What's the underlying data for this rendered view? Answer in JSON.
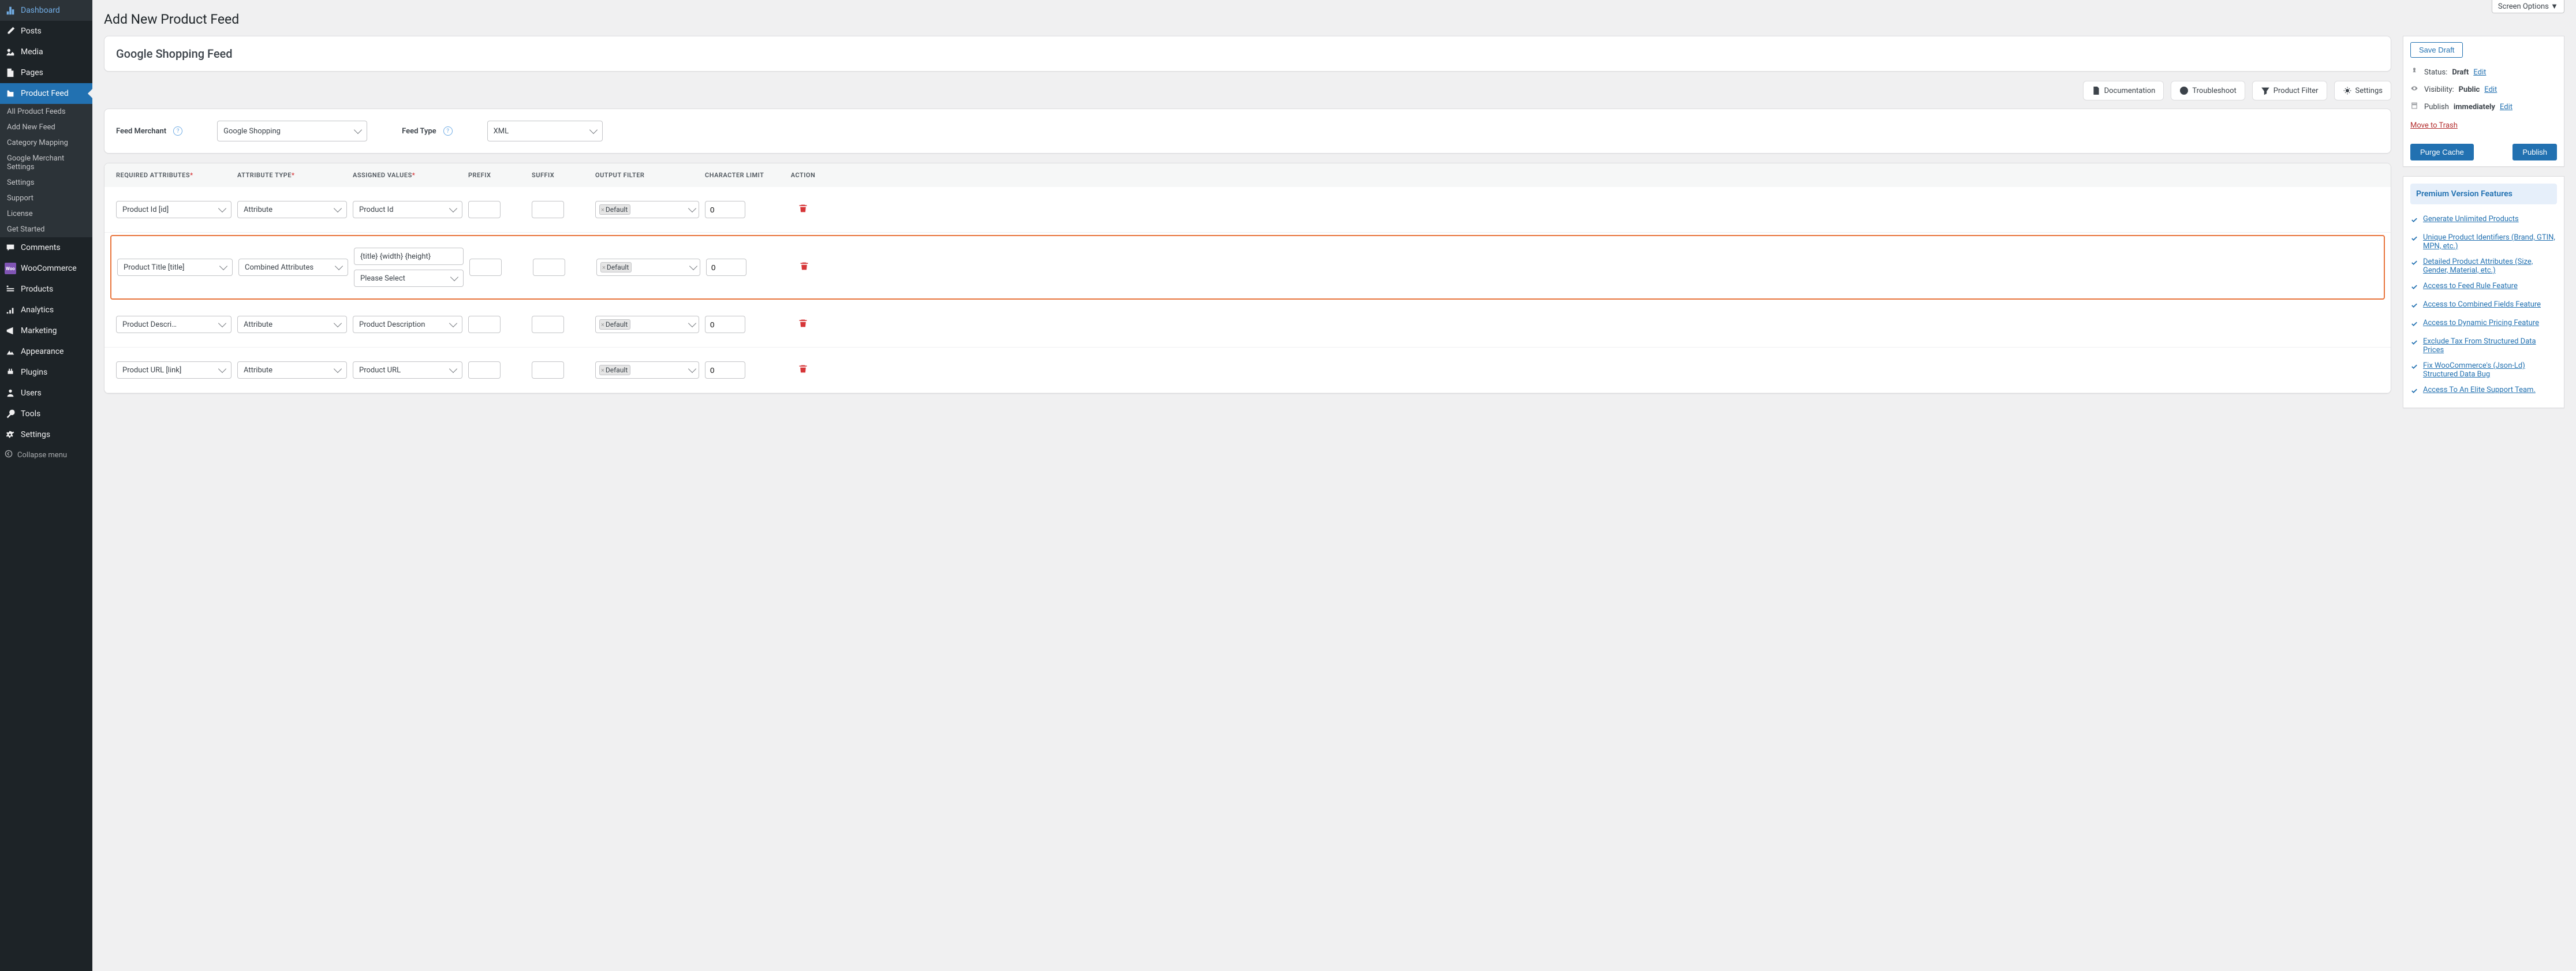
{
  "screen_options": "Screen Options",
  "page_title": "Add New Product Feed",
  "sidebar": {
    "items": [
      {
        "label": "Dashboard",
        "icon": "dashboard"
      },
      {
        "label": "Posts",
        "icon": "posts"
      },
      {
        "label": "Media",
        "icon": "media"
      },
      {
        "label": "Pages",
        "icon": "pages"
      },
      {
        "label": "Product Feed",
        "icon": "product-feed",
        "active": true
      },
      {
        "label": "Comments",
        "icon": "comments"
      },
      {
        "label": "WooCommerce",
        "icon": "woocommerce"
      },
      {
        "label": "Products",
        "icon": "products"
      },
      {
        "label": "Analytics",
        "icon": "analytics"
      },
      {
        "label": "Marketing",
        "icon": "marketing"
      },
      {
        "label": "Appearance",
        "icon": "appearance"
      },
      {
        "label": "Plugins",
        "icon": "plugins"
      },
      {
        "label": "Users",
        "icon": "users"
      },
      {
        "label": "Tools",
        "icon": "tools"
      },
      {
        "label": "Settings",
        "icon": "settings"
      }
    ],
    "submenu": [
      "All Product Feeds",
      "Add New Feed",
      "Category Mapping",
      "Google Merchant Settings",
      "Settings",
      "Support",
      "License",
      "Get Started"
    ],
    "collapse": "Collapse menu"
  },
  "feed_title": "Google Shopping Feed",
  "toolbar": {
    "documentation": "Documentation",
    "troubleshoot": "Troubleshoot",
    "product_filter": "Product Filter",
    "settings": "Settings"
  },
  "config": {
    "merchant_label": "Feed Merchant",
    "merchant_value": "Google Shopping",
    "type_label": "Feed Type",
    "type_value": "XML"
  },
  "table": {
    "headers": {
      "required": "Required Attributes",
      "attr_type": "Attribute Type",
      "assigned": "Assigned Values",
      "prefix": "Prefix",
      "suffix": "Suffix",
      "output": "Output Filter",
      "charlimit": "Character Limit",
      "action": "Action"
    },
    "rows": [
      {
        "required": "Product Id [id]",
        "attr_type": "Attribute",
        "assigned": "Product Id",
        "prefix": "",
        "suffix": "",
        "output_filter": "Default",
        "char_limit": "0"
      },
      {
        "required": "Product Title [title]",
        "attr_type": "Combined Attributes",
        "assigned": "{title} {width} {height}",
        "assigned2": "Please Select",
        "prefix": "",
        "suffix": "",
        "output_filter": "Default",
        "char_limit": "0",
        "highlighted": true
      },
      {
        "required": "Product Description [description]",
        "attr_type": "Attribute",
        "assigned": "Product Description",
        "prefix": "",
        "suffix": "",
        "output_filter": "Default",
        "char_limit": "0"
      },
      {
        "required": "Product URL [link]",
        "attr_type": "Attribute",
        "assigned": "Product URL",
        "prefix": "",
        "suffix": "",
        "output_filter": "Default",
        "char_limit": "0"
      }
    ]
  },
  "publish": {
    "save_draft": "Save Draft",
    "status_label": "Status:",
    "status_value": "Draft",
    "visibility_label": "Visibility:",
    "visibility_value": "Public",
    "publish_label": "Publish",
    "publish_value": "immediately",
    "edit": "Edit",
    "trash": "Move to Trash",
    "purge": "Purge Cache",
    "publish_btn": "Publish"
  },
  "premium": {
    "title": "Premium Version Features",
    "features": [
      "Generate Unlimited Products",
      "Unique Product Identifiers (Brand, GTIN, MPN, etc.)",
      "Detailed Product Attributes (Size, Gender, Material, etc.)",
      "Access to Feed Rule Feature",
      "Access to Combined Fields Feature",
      "Access to Dynamic Pricing Feature",
      "Exclude Tax From Structured Data Prices",
      "Fix WooCommerce's (Json-Ld) Structured Data Bug",
      "Access To An Elite Support Team."
    ]
  }
}
